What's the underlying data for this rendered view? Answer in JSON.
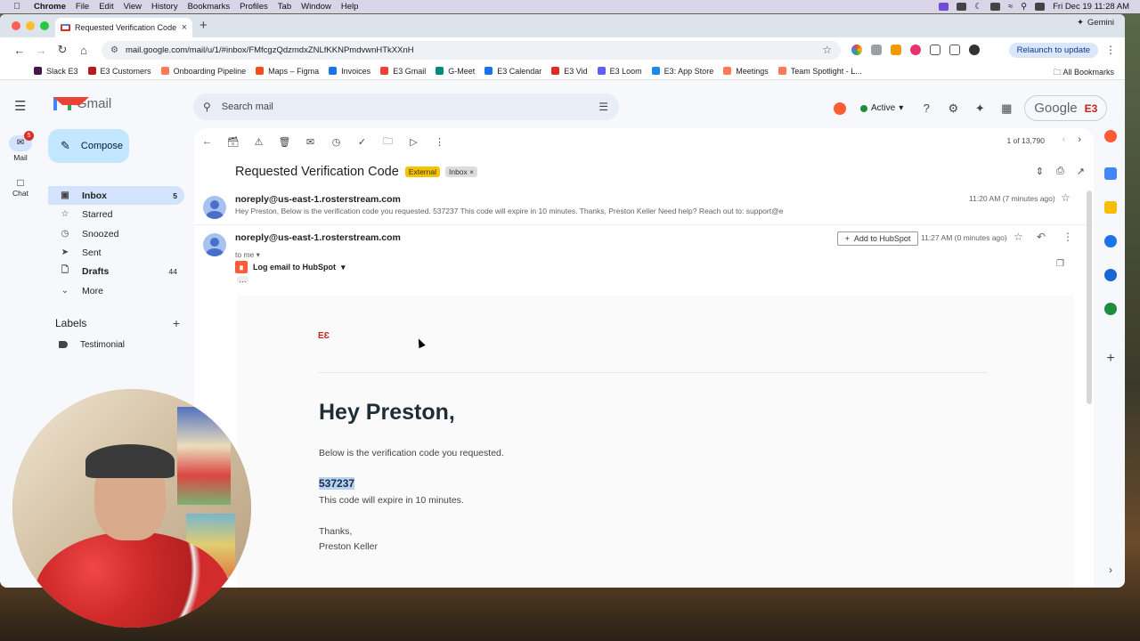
{
  "menubar": {
    "app": "Chrome",
    "items": [
      "File",
      "Edit",
      "View",
      "History",
      "Bookmarks",
      "Profiles",
      "Tab",
      "Window",
      "Help"
    ],
    "datetime": "Fri Dec 19  11:28 AM"
  },
  "browser": {
    "tab_title": "Requested Verification Code",
    "gemini_label": "Gemini",
    "url": "mail.google.com/mail/u/1/#inbox/FMfcgzQdzmdxZNLfKKNPmdvwnHTkXXnH",
    "relaunch_label": "Relaunch to update",
    "bookmarks": [
      {
        "label": "Slack  E3",
        "color": "#4a154b"
      },
      {
        "label": "E3 Customers",
        "color": "#b81d1d"
      },
      {
        "label": "Onboarding Pipeline",
        "color": "#ff7a59"
      },
      {
        "label": "Maps – Figma",
        "color": "#f24e1e"
      },
      {
        "label": "Invoices",
        "color": "#1a73e8"
      },
      {
        "label": "E3 Gmail",
        "color": "#ea4335"
      },
      {
        "label": "G-Meet",
        "color": "#00897b"
      },
      {
        "label": "E3 Calendar",
        "color": "#1a73e8"
      },
      {
        "label": "E3 Vid",
        "color": "#d93025"
      },
      {
        "label": "E3 Loom",
        "color": "#625df5"
      },
      {
        "label": "E3: App Store",
        "color": "#1e88e5"
      },
      {
        "label": "Meetings",
        "color": "#ff7a59"
      },
      {
        "label": "Team Spotlight - L...",
        "color": "#ff7a59"
      }
    ],
    "all_bookmarks": "All Bookmarks"
  },
  "gmail": {
    "product_name": "Gmail",
    "rail": {
      "mail_label": "Mail",
      "mail_badge": "5",
      "chat_label": "Chat"
    },
    "compose_label": "Compose",
    "nav": [
      {
        "icon": "inbox-icon",
        "label": "Inbox",
        "count": "5",
        "selected": true
      },
      {
        "icon": "star-icon",
        "label": "Starred",
        "count": ""
      },
      {
        "icon": "clock-icon",
        "label": "Snoozed",
        "count": ""
      },
      {
        "icon": "send-icon",
        "label": "Sent",
        "count": ""
      },
      {
        "icon": "draft-icon",
        "label": "Drafts",
        "count": "44"
      },
      {
        "icon": "chevron-down-icon",
        "label": "More",
        "count": ""
      }
    ],
    "labels_heading": "Labels",
    "labels": [
      {
        "label": "Testimonial"
      }
    ],
    "search_placeholder": "Search mail",
    "status": "Active",
    "account_brand": "Google",
    "account_badge": "E3",
    "pager": "1 of 13,790",
    "subject": "Requested Verification Code",
    "chip_external": "External",
    "chip_inbox": "Inbox",
    "messages": [
      {
        "sender": "noreply@us-east-1.rosterstream.com",
        "snippet": "Hey Preston, Below is the verification code you requested. 537237 This code will expire in 10 minutes. Thanks, Preston Keller Need help? Reach out to: support@e",
        "time": "11:20 AM (7 minutes ago)"
      },
      {
        "sender": "noreply@us-east-1.rosterstream.com",
        "to": "to me",
        "time": "11:27 AM (0 minutes ago)",
        "add_hubspot": "Add to HubSpot",
        "log_email": "Log email to HubSpot"
      }
    ],
    "email_body": {
      "logo_text": "E",
      "greeting": "Hey Preston,",
      "intro": "Below is the verification code you requested.",
      "code": "537237",
      "expire": "This code will expire in 10 minutes.",
      "thanks": "Thanks,",
      "signature": "Preston Keller"
    }
  }
}
